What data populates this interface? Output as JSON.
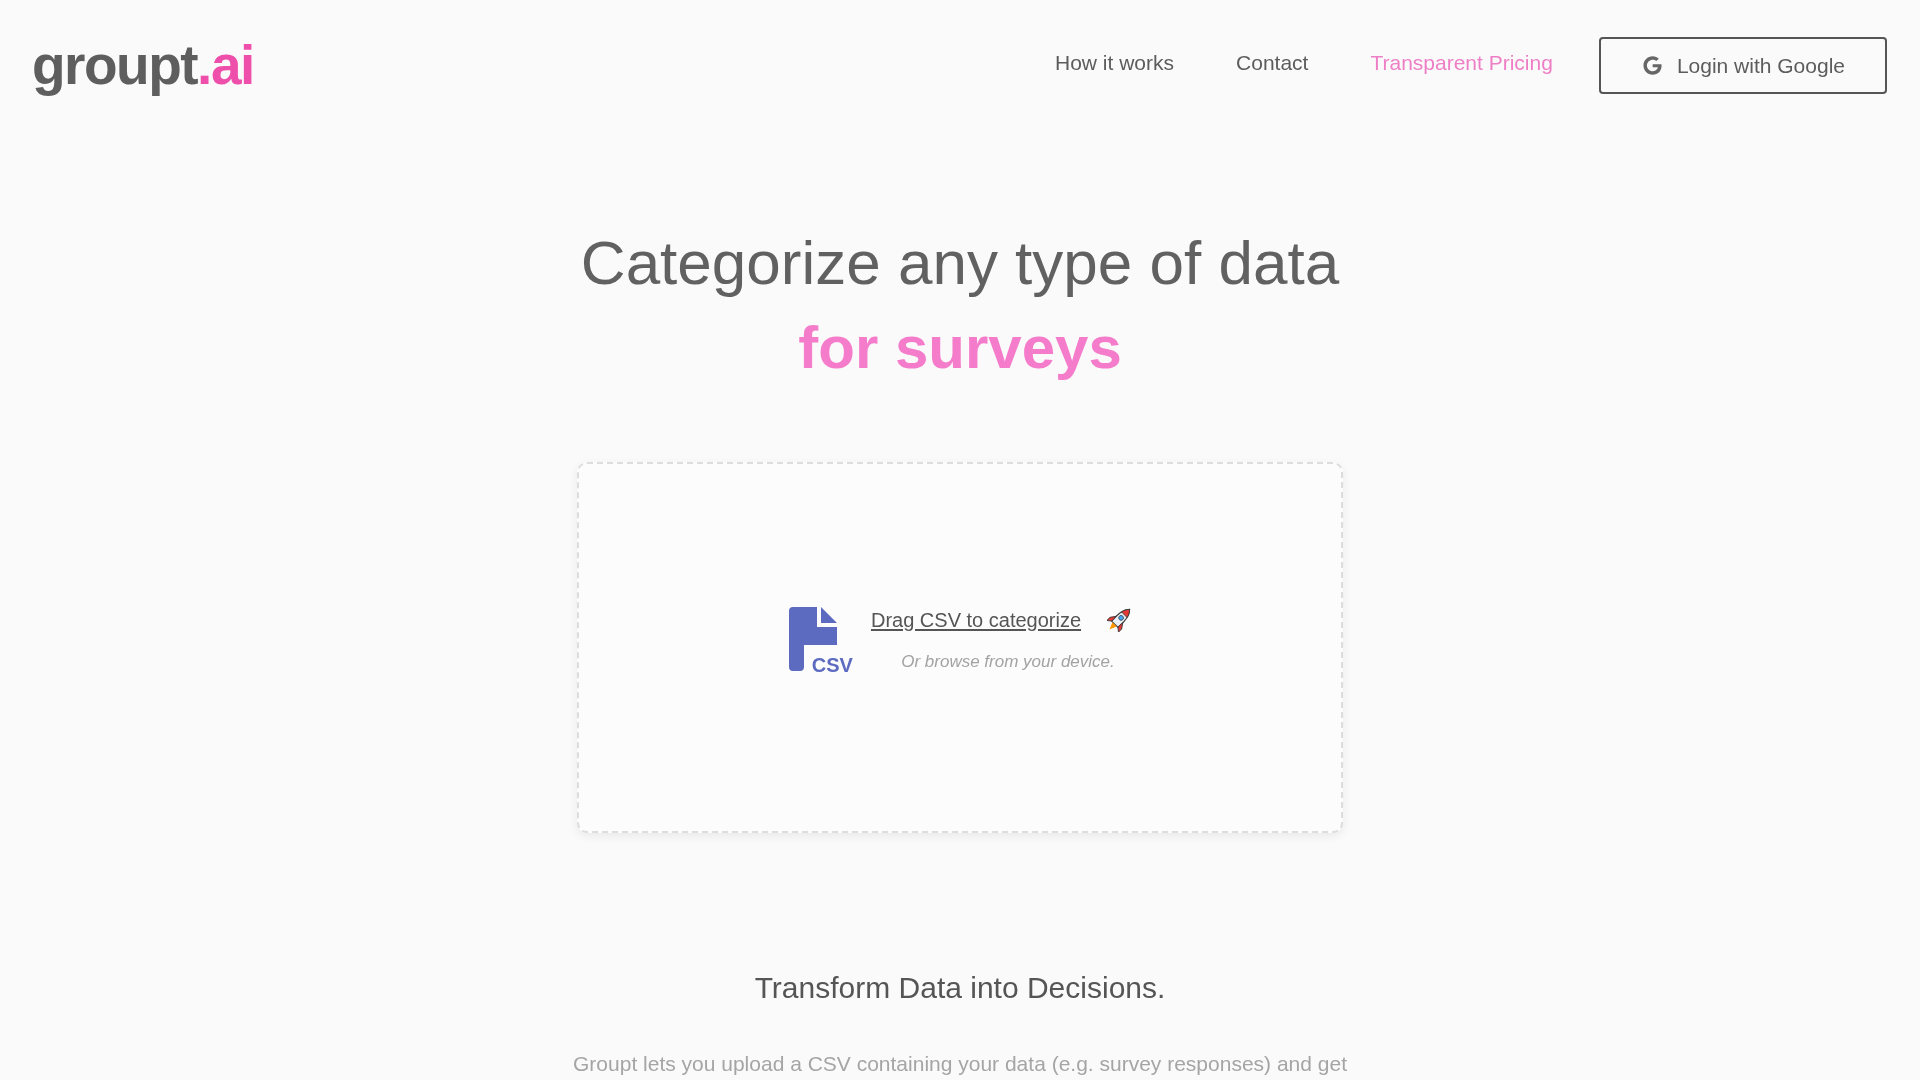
{
  "header": {
    "logo": {
      "name": "groupt",
      "suffix": ".ai"
    },
    "nav": [
      {
        "label": "How it works",
        "kind": "link"
      },
      {
        "label": "Contact",
        "kind": "link"
      },
      {
        "label": "Transparent Pricing",
        "kind": "accent"
      }
    ],
    "login_button": "Login with Google"
  },
  "hero": {
    "title": "Categorize any type of data",
    "highlight": "for surveys"
  },
  "upload": {
    "file_type": "CSV",
    "prompt": "Drag CSV to categorize",
    "hint": "Or browse from your device."
  },
  "intro": {
    "heading": "Transform Data into Decisions.",
    "text": "Groupt lets you upload a CSV containing your data (e.g. survey responses) and get"
  }
}
